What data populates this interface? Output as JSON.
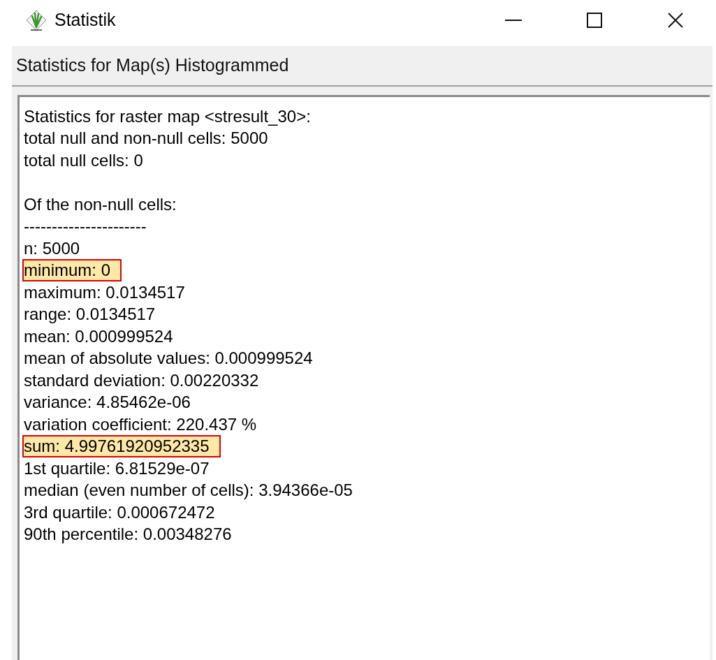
{
  "window": {
    "title": "Statistik"
  },
  "header": "Statistics for Map(s) Histogrammed",
  "lines": [
    {
      "kind": "text",
      "text": "Statistics for raster map <stresult_30>:",
      "highlighted": false
    },
    {
      "kind": "text",
      "text": "total null and non-null cells: 5000",
      "highlighted": false
    },
    {
      "kind": "text",
      "text": "total null cells: 0",
      "highlighted": false
    },
    {
      "kind": "blank"
    },
    {
      "kind": "text",
      "text": "Of the non-null cells:",
      "highlighted": false
    },
    {
      "kind": "text",
      "text": "----------------------",
      "highlighted": false
    },
    {
      "kind": "text",
      "text": "n: 5000",
      "highlighted": false
    },
    {
      "kind": "text",
      "text": "minimum: 0",
      "highlighted": true
    },
    {
      "kind": "text",
      "text": "maximum: 0.0134517",
      "highlighted": false
    },
    {
      "kind": "text",
      "text": "range: 0.0134517",
      "highlighted": false
    },
    {
      "kind": "text",
      "text": "mean: 0.000999524",
      "highlighted": false
    },
    {
      "kind": "text",
      "text": "mean of absolute values: 0.000999524",
      "highlighted": false
    },
    {
      "kind": "text",
      "text": "standard deviation: 0.00220332",
      "highlighted": false
    },
    {
      "kind": "text",
      "text": "variance: 4.85462e-06",
      "highlighted": false
    },
    {
      "kind": "text",
      "text": "variation coefficient: 220.437 %",
      "highlighted": false
    },
    {
      "kind": "text",
      "text": "sum: 4.99761920952335",
      "highlighted": true
    },
    {
      "kind": "text",
      "text": "1st quartile: 6.81529e-07",
      "highlighted": false
    },
    {
      "kind": "text",
      "text": "median (even number of cells): 3.94366e-05",
      "highlighted": false
    },
    {
      "kind": "text",
      "text": "3rd quartile: 0.000672472",
      "highlighted": false
    },
    {
      "kind": "text",
      "text": "90th percentile: 0.00348276",
      "highlighted": false
    }
  ]
}
